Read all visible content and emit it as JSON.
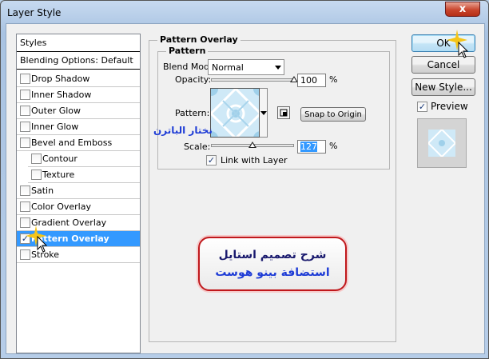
{
  "window": {
    "title": "Layer Style",
    "close_symbol": "x"
  },
  "styles_panel": {
    "header": "Styles",
    "blending_options": "Blending Options: Default",
    "items": [
      {
        "label": "Drop Shadow",
        "checked": false
      },
      {
        "label": "Inner Shadow",
        "checked": false
      },
      {
        "label": "Outer Glow",
        "checked": false
      },
      {
        "label": "Inner Glow",
        "checked": false
      },
      {
        "label": "Bevel and Emboss",
        "checked": false
      },
      {
        "label": "Contour",
        "checked": false
      },
      {
        "label": "Texture",
        "checked": false
      },
      {
        "label": "Satin",
        "checked": false
      },
      {
        "label": "Color Overlay",
        "checked": false
      },
      {
        "label": "Gradient Overlay",
        "checked": false
      },
      {
        "label": "Pattern Overlay",
        "checked": true
      },
      {
        "label": "Stroke",
        "checked": false
      }
    ]
  },
  "pattern_overlay": {
    "group_title": "Pattern Overlay",
    "subgroup_title": "Pattern",
    "blend_mode_label": "Blend Mode:",
    "blend_mode_value": "Normal",
    "opacity_label": "Opacity:",
    "opacity_value": "100",
    "percent": "%",
    "opacity_fraction": 1.0,
    "pattern_label": "Pattern:",
    "snap_button": "Snap to Origin",
    "scale_label": "Scale:",
    "scale_value": "127",
    "scale_fraction": 0.127,
    "link_label": "Link with Layer",
    "link_checked": true
  },
  "buttons": {
    "ok": "OK",
    "cancel": "Cancel",
    "new_style": "New Style...",
    "preview_label": "Preview",
    "preview_checked": true
  },
  "annotations": {
    "pattern_caption": "نختار الباترن",
    "banner_line1": "شرح تصميم استايل",
    "banner_line2": "استضافة بينو هوست"
  },
  "colors": {
    "selection": "#3399ff",
    "banner_border": "#c0181c",
    "caption_blue": "#1e3cd6"
  }
}
